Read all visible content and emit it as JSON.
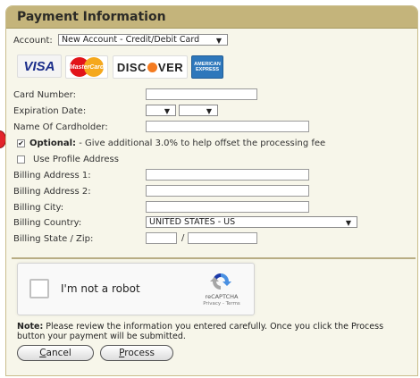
{
  "panel": {
    "title": "Payment Information"
  },
  "account": {
    "label": "Account:",
    "selected": "New Account - Credit/Debit Card"
  },
  "cards": {
    "visa": "VISA",
    "mastercard": "MasterCard",
    "discover_pre": "DISC",
    "discover_post": "VER",
    "amex_line1": "AMERICAN",
    "amex_line2": "EXPRESS"
  },
  "fields": {
    "card_number": "Card Number:",
    "expiration": "Expiration Date:",
    "cardholder": "Name Of Cardholder:",
    "address1": "Billing Address 1:",
    "address2": "Billing Address 2:",
    "city": "Billing City:",
    "country": "Billing Country:",
    "state_zip": "Billing State / Zip:"
  },
  "country_selected": "UNITED STATES - US",
  "zip_separator": "/",
  "optional": {
    "strong": "Optional:",
    "text": " - Give additional 3.0% to help offset the processing fee",
    "checked": true
  },
  "profile_address": {
    "label": "Use Profile Address",
    "checked": false
  },
  "recaptcha": {
    "label": "I'm not a robot",
    "brand": "reCAPTCHA",
    "terms": "Privacy - Terms"
  },
  "note": {
    "strong": "Note:",
    "text": " Please review the information you entered carefully. Once you click the Process button your payment will be submitted."
  },
  "buttons": {
    "cancel_accel": "C",
    "cancel_rest": "ancel",
    "process_accel": "P",
    "process_rest": "rocess"
  },
  "colors": {
    "header": "#c4b47b",
    "panel_bg": "#f7f6ea",
    "annotation_dot": "#e3242b"
  }
}
